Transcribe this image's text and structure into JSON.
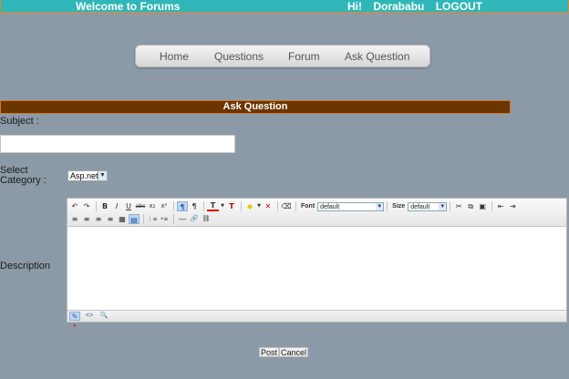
{
  "header": {
    "welcome": "Welcome to Forums",
    "greeting": "Hi!",
    "username": "Dorababu",
    "logout": "LOGOUT"
  },
  "nav": {
    "items": [
      "Home",
      "Questions",
      "Forum",
      "Ask Question"
    ]
  },
  "section": {
    "title": "Ask Question"
  },
  "form": {
    "subject_label": "Subject :",
    "subject_value": "",
    "category_label_line1": "Select",
    "category_label_line2": "Category :",
    "category_value": "Asp.net",
    "description_label": "Description",
    "required_mark": "*"
  },
  "editor": {
    "font_label": "Font",
    "font_value": "default",
    "size_label": "Size",
    "size_value": "default",
    "icons": {
      "undo": "↶",
      "redo": "↷",
      "bold": "B",
      "italic": "I",
      "underline": "U",
      "strike": "abc",
      "subscript": "x₂",
      "superscript": "x²",
      "ltr": "¶",
      "rtl": "¶",
      "font_color": "T",
      "remove_format": "T",
      "highlight": "◆",
      "clear_highlight": "✕",
      "eraser": "⌫",
      "cut": "✂",
      "copy": "⧉",
      "paste": "▣",
      "outdent": "⇤",
      "indent": "⇥",
      "align_left": "≡",
      "align_center": "≡",
      "align_right": "≡",
      "justify": "≡",
      "align_full": "▦",
      "ordered_list": "⋮≡",
      "unordered_list": "•≡",
      "hr": "―",
      "link": "🔗",
      "unlink": "⛓",
      "design_mode": "✎",
      "html_mode": "<>",
      "preview_mode": "🔍"
    }
  },
  "buttons": {
    "post": "Post",
    "cancel": "Cancel"
  },
  "colors": {
    "background": "#8c9aa8",
    "topbar": "#2fb6b8",
    "topbar_border": "#e08a1a",
    "section_bar": "#6b3500",
    "font_color_underline": "#e00000"
  }
}
